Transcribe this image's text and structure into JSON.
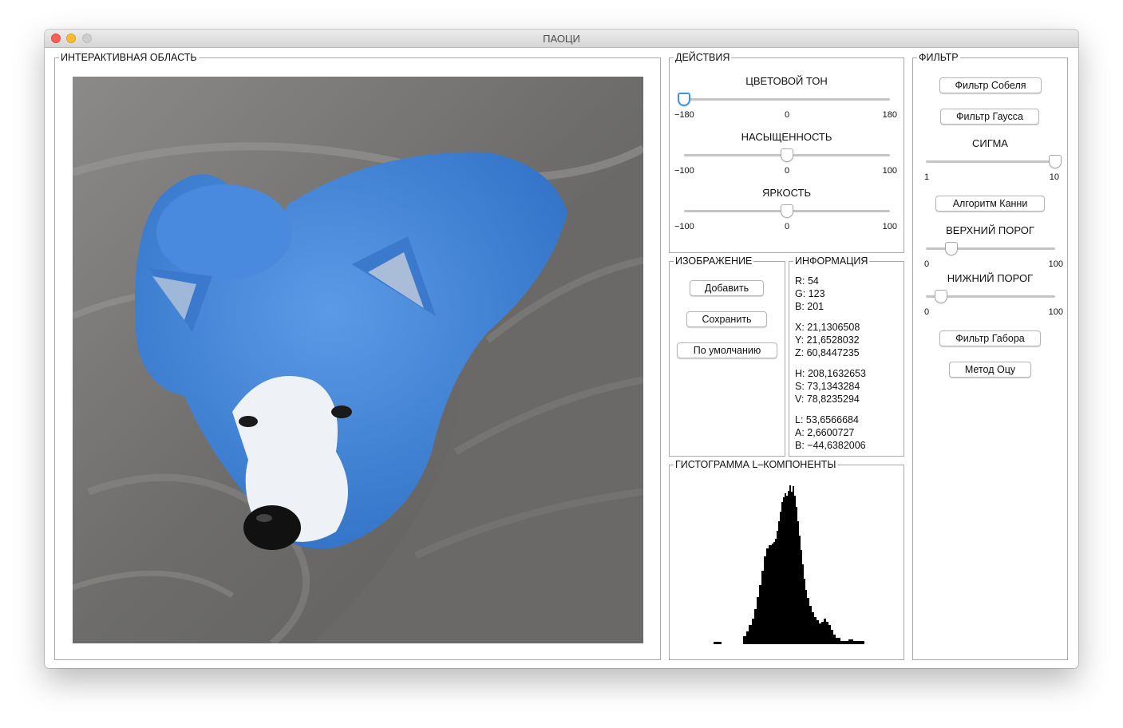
{
  "window": {
    "title": "ПАОЦИ",
    "controls": [
      "close-button",
      "minimize-button",
      "zoom-button"
    ]
  },
  "interactive_area": {
    "title": "ИНТЕРАКТИВНАЯ ОБЛАСТЬ",
    "image_subject": "blue-tinted dog lying on grey blanket"
  },
  "actions": {
    "title": "ДЕЙСТВИЯ",
    "sliders": [
      {
        "label": "ЦВЕТОВОЙ ТОН",
        "min": "−180",
        "mid": "0",
        "max": "180",
        "value": -180,
        "range": [
          -180,
          180
        ]
      },
      {
        "label": "НАСЫЩЕННОСТЬ",
        "min": "−100",
        "mid": "0",
        "max": "100",
        "value": 0,
        "range": [
          -100,
          100
        ]
      },
      {
        "label": "ЯРКОСТЬ",
        "min": "−100",
        "mid": "0",
        "max": "100",
        "value": 0,
        "range": [
          -100,
          100
        ]
      }
    ]
  },
  "image_panel": {
    "title": "ИЗОБРАЖЕНИЕ",
    "buttons": [
      "Добавить",
      "Сохранить",
      "По умолчанию"
    ]
  },
  "info_panel": {
    "title": "ИНФОРМАЦИЯ",
    "lines": [
      "R: 54",
      "G: 123",
      "B: 201",
      "X: 21,1306508",
      "Y: 21,6528032",
      "Z: 60,8447235",
      "H: 208,1632653",
      "S: 73,1343284",
      "V: 78,8235294",
      "L: 53,6566684",
      "A: 2,6600727",
      "B: −44,6382006"
    ]
  },
  "histogram": {
    "title": "ГИСТОГРАММА L–КОМПОНЕНТЫ"
  },
  "filter_panel": {
    "title": "ФИЛЬТР",
    "buttons": {
      "sobel": "Фильтр Собеля",
      "gauss": "Фильтр Гаусса",
      "canny": "Алгоритм Канни",
      "gabor": "Фильтр Габора",
      "otsu": "Метод Оцу"
    },
    "sigma": {
      "label": "СИГМА",
      "min": "1",
      "max": "10",
      "value": 10,
      "range": [
        1,
        10
      ]
    },
    "upper_threshold": {
      "label": "ВЕРХНИЙ ПОРОГ",
      "min": "0",
      "max": "100",
      "value": 20,
      "range": [
        0,
        100
      ]
    },
    "lower_threshold": {
      "label": "НИЖНИЙ ПОРОГ",
      "min": "0",
      "max": "100",
      "value": 12,
      "range": [
        0,
        100
      ]
    }
  },
  "colors": {
    "window_bg": "#ececec",
    "panel_border": "#a8a8a8",
    "slider_accent": "#3f8ef0",
    "dog_blue": "#3f7fd2",
    "blanket_grey": "#6f6e6c"
  }
}
